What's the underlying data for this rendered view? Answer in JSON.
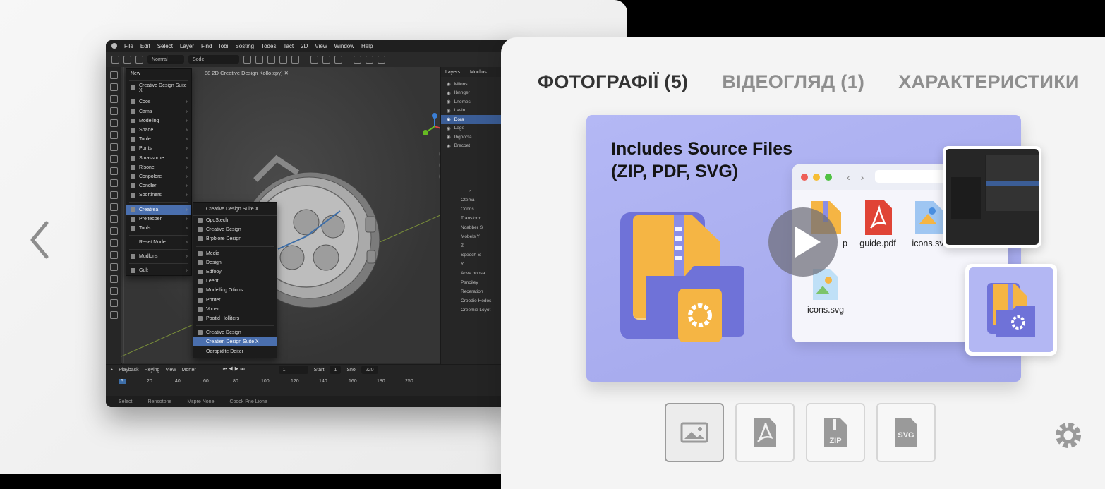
{
  "app": {
    "menu": [
      "File",
      "Edit",
      "Select",
      "Layer",
      "Find",
      "Iobi",
      "Sosting",
      "Todes",
      "Tact",
      "2D",
      "View",
      "Window",
      "Help"
    ],
    "toolbar": {
      "mode": "Nomral",
      "field": "Sode"
    },
    "file_tab": "88 2D Creative Design Kollo.xpy)",
    "menu1": {
      "top_items": [
        "New",
        "Creative Design Suite X"
      ],
      "items": [
        "Coos",
        "Cams",
        "Modeling",
        "Spade",
        "Toole",
        "Ponts",
        "Smassorne",
        "Rlsone",
        "Conpolore",
        "Condler",
        "Soortiners",
        "Creatrea",
        "Preitecoer",
        "Tools"
      ],
      "bottom_items": [
        "Reset Mode",
        "Mudlons",
        "Gult"
      ],
      "selected": "Creatrea"
    },
    "menu2": {
      "header": "Creative Design Suite X",
      "group1": [
        "OpoStech",
        "Creative Design",
        "Brpbiore Design"
      ],
      "group2": [
        "Media",
        "Design",
        "Edfooy",
        "Leent",
        "Modelling Otions",
        "Ponter",
        "Vooer",
        "Pootid Holliters"
      ],
      "group3": [
        "Creative Design",
        "Creatien Design Suite X",
        "Ooropidite Deiter"
      ],
      "selected": "Creatien Design Suite X"
    },
    "right_tabs": [
      "Layers",
      "Moclios"
    ],
    "layers": [
      "Mlions",
      "Ibnnger",
      "Lnomes",
      "Lavin",
      "Dora",
      "Lege",
      "Ibgoocta",
      "Brecoet"
    ],
    "props": {
      "search": "Otema",
      "field": "Conns",
      "section": "Transform",
      "rows": [
        "Noabber S",
        "Mobels Y",
        "Z",
        "Speoch S",
        "Y"
      ],
      "sections": [
        "Adve bopsa",
        "Psnoiley",
        "Receration",
        "Croodie Hodos",
        "Creemie Loyot"
      ]
    },
    "timeline": {
      "labels": [
        "Playback",
        "Reying",
        "View",
        "Morter"
      ],
      "frame": "1",
      "start_label": "Start",
      "start": "1",
      "end_label": "Sno",
      "end": "220",
      "ticks": [
        "5",
        "20",
        "40",
        "60",
        "80",
        "100",
        "120",
        "140",
        "160",
        "180",
        "250"
      ]
    },
    "status": [
      "Select",
      "Rensotone",
      "Mspre None",
      "Coock Pne Lione"
    ]
  },
  "product": {
    "tabs": [
      "ФОТОГРАФІЇ (5)",
      "ВІДЕОГЛЯД (1)",
      "ХАРАКТЕРИСТИКИ"
    ],
    "hero_title_line1": "Includes Source Files",
    "hero_title_line2": "(ZIP, PDF, SVG)",
    "files": [
      "p",
      "guide.pdf",
      "icons.sv",
      "icons.svg"
    ],
    "thumbs": [
      "image",
      "pdf",
      "ZIP",
      "SVG"
    ]
  },
  "colors": {
    "hero_bg": "#aeb2f2",
    "folder_orange": "#f5b544",
    "folder_purple": "#6f72d8",
    "pdf_red": "#e04436",
    "menu_select": "#4a6fae"
  }
}
